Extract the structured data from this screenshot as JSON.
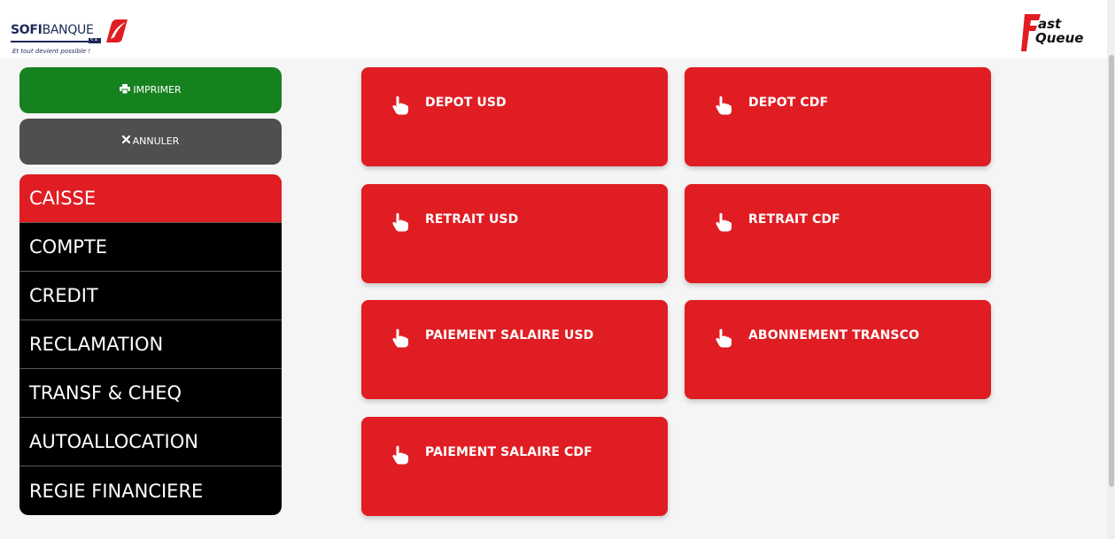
{
  "header": {
    "logo_left": {
      "brand_bold": "SOFI",
      "brand_rest": "BANQUE",
      "suffix": "S.A.",
      "tagline": "Et tout devient possible !"
    },
    "logo_right": {
      "line1": "ast",
      "line2": "Queue"
    }
  },
  "actions": {
    "print_label": "IMPRIMER",
    "cancel_label": "ANNULER"
  },
  "menu": {
    "items": [
      {
        "label": "CAISSE"
      },
      {
        "label": "COMPTE"
      },
      {
        "label": "CREDIT"
      },
      {
        "label": "RECLAMATION"
      },
      {
        "label": "TRANSF & CHEQ"
      },
      {
        "label": "AUTOALLOCATION"
      },
      {
        "label": "REGIE FINANCIERE"
      }
    ],
    "active": "CAISSE"
  },
  "services": {
    "tiles": [
      {
        "label": "DEPOT USD"
      },
      {
        "label": "DEPOT CDF"
      },
      {
        "label": "RETRAIT USD"
      },
      {
        "label": "RETRAIT CDF"
      },
      {
        "label": "PAIEMENT SALAIRE USD"
      },
      {
        "label": "ABONNEMENT TRANSCO"
      },
      {
        "label": "PAIEMENT SALAIRE CDF"
      }
    ]
  },
  "colors": {
    "accent_red": "#e01d23",
    "print_green": "#15821f",
    "cancel_gray": "#4f4f4f",
    "menu_black": "#000000",
    "brand_navy": "#1c2a55"
  },
  "icons": {
    "print": "printer-icon",
    "cancel": "close-icon",
    "tile": "hand-pointer-icon"
  }
}
